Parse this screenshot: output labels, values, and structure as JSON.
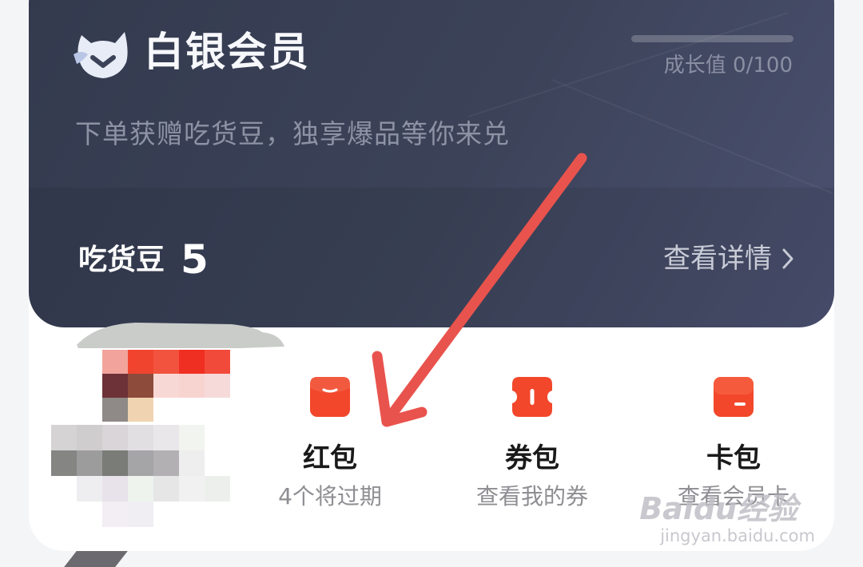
{
  "member": {
    "tier_title": "白银会员",
    "growth_text": "成长值 0/100",
    "growth_progress": 0,
    "subtitle": "下单获赠吃货豆，独享爆品等你来兑",
    "beans_label": "吃货豆",
    "beans_value": "5",
    "details_link": "查看详情",
    "logo_icon": "crown-shield-icon"
  },
  "quick_entries": [
    {
      "title": "红包",
      "subtitle": "4个将过期",
      "icon": "red-packet-icon"
    },
    {
      "title": "券包",
      "subtitle": "查看我的券",
      "icon": "coupon-icon"
    },
    {
      "title": "卡包",
      "subtitle": "查看会员卡",
      "icon": "card-icon"
    }
  ],
  "watermark": {
    "brand": "Baidu经验",
    "url": "jingyan.baidu.com"
  },
  "colors": {
    "card_dark": "#3a4055",
    "accent_red": "#f2472b",
    "arrow_red": "#e9534d"
  }
}
